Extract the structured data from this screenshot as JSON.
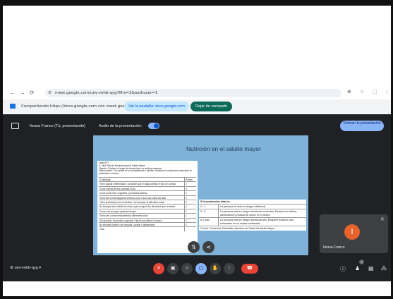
{
  "browser": {
    "url": "meet.google.com/uev-vohb-qyg?lfhs=2&authuser=1",
    "nav": [
      "←",
      "→",
      "⟳"
    ],
    "right_icons": [
      "⊕",
      "☆",
      "⬚",
      "⋮"
    ]
  },
  "share_bar": {
    "text": "Compartiendo https://docs.google.com con meet.google.com",
    "view_tab_label": "Ver la pestaña: docs.google.com",
    "stop_label": "Dejar de compartir"
  },
  "meet": {
    "presenter": "Ileana Franco (Tú, presentando)",
    "audio_label": "Audio de la presentación",
    "stop_presenting_label": "Detener la presentación",
    "meeting_code": "uev-vohb-qyg",
    "participant_name": "Ileana Franco",
    "participant_initial": "I",
    "participants_count": "2"
  },
  "slide": {
    "title": "Nutrición en el adulto mayor",
    "doc_header": "Tarea N°7\nA. MNA Test de Nutrición para el Adulto Mayor\nObjetivo: Evaluar el riesgo de desnutrición en adultos mayores.\nInstrucciones: Con ayuda de un compañero/a o familiar, conteste el cuestionario marcando la puntuación correcta.",
    "doc_table_head": [
      "El tamizaje",
      "Puntos"
    ],
    "doc_rows": [
      [
        "Tiene alguna enfermedad o condición que le haga cambiar el tipo de comida",
        "2"
      ],
      [
        "Come menos de dos comidas al día",
        "3"
      ],
      [
        "Come poca fruta, vegetales o productos lácteos",
        "2"
      ],
      [
        "Toma tres o más tragos de cerveza, licor o vino casi todos los días",
        "2"
      ],
      [
        "Tiene problemas con los dientes o la boca que le dificultan comer",
        "2"
      ],
      [
        "No siempre tiene suficiente dinero para comprar los alimentos que necesita",
        "4"
      ],
      [
        "Come solo la mayor parte del tiempo",
        "1"
      ],
      [
        "Toma tres o más medicamentos diferentes al día",
        "1"
      ],
      [
        "Sin quererlo, ha perdido o ganado 5 kg en los últimos 6 meses",
        "2"
      ],
      [
        "No siempre puede ir de compras, cocinar o alimentarse",
        "2"
      ],
      [
        "Total",
        ""
      ]
    ],
    "score_title": "Si la puntuación total es:",
    "score_rows": [
      [
        "0 - 2",
        "La persona no está en riesgo nutricional."
      ],
      [
        "3 - 5",
        "La persona está en riesgo nutricional moderado. Revisar los hábitos alimentarios y evaluar de nuevo en 3 meses."
      ],
      [
        "6 o más",
        "La persona está en riesgo nutricional alto. Requiere examen más exhaustivo de su estado nutricional."
      ]
    ],
    "score_source": "Fuente: Desarrollo Saludable: Atención de Salud del Adulto Mayor"
  },
  "colors": {
    "meet_bg": "#202124",
    "slide_bg": "#7fb2d8",
    "accent_blue": "#8ab4f8",
    "hangup_red": "#ea4335",
    "avatar_orange": "#e8632b"
  }
}
